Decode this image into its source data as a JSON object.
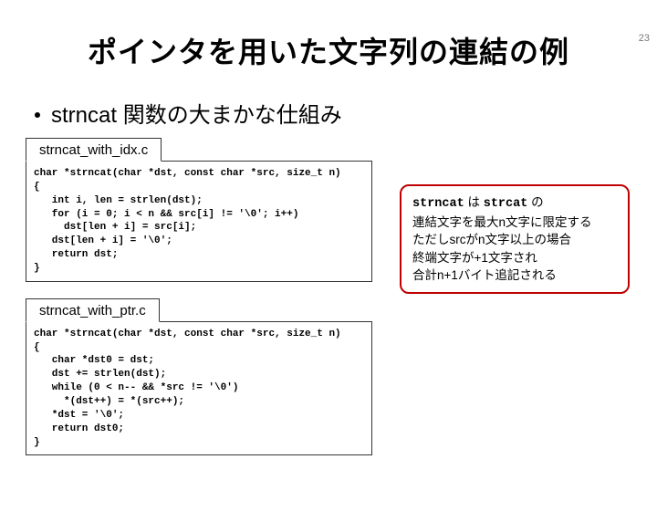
{
  "pageNumber": "23",
  "title": "ポインタを用いた文字列の連結の例",
  "subtitle": "strncat 関数の大まかな仕組み",
  "code1": {
    "filename": "strncat_with_idx.c",
    "code": "char *strncat(char *dst, const char *src, size_t n)\n{\n   int i, len = strlen(dst);\n   for (i = 0; i < n && src[i] != '\\0'; i++)\n     dst[len + i] = src[i];\n   dst[len + i] = '\\0';\n   return dst;\n}"
  },
  "code2": {
    "filename": "strncat_with_ptr.c",
    "code": "char *strncat(char *dst, const char *src, size_t n)\n{\n   char *dst0 = dst;\n   dst += strlen(dst);\n   while (0 < n-- && *src != '\\0')\n     *(dst++) = *(src++);\n   *dst = '\\0';\n   return dst0;\n}"
  },
  "note": {
    "l1a": "strncat",
    "l1b": " は ",
    "l1c": "strcat",
    "l1d": " の",
    "l2": "連結文字を最大n文字に限定する",
    "l3": "ただしsrcがn文字以上の場合",
    "l4": "終端文字が+1文字され",
    "l5": "合計n+1バイト追記される"
  }
}
